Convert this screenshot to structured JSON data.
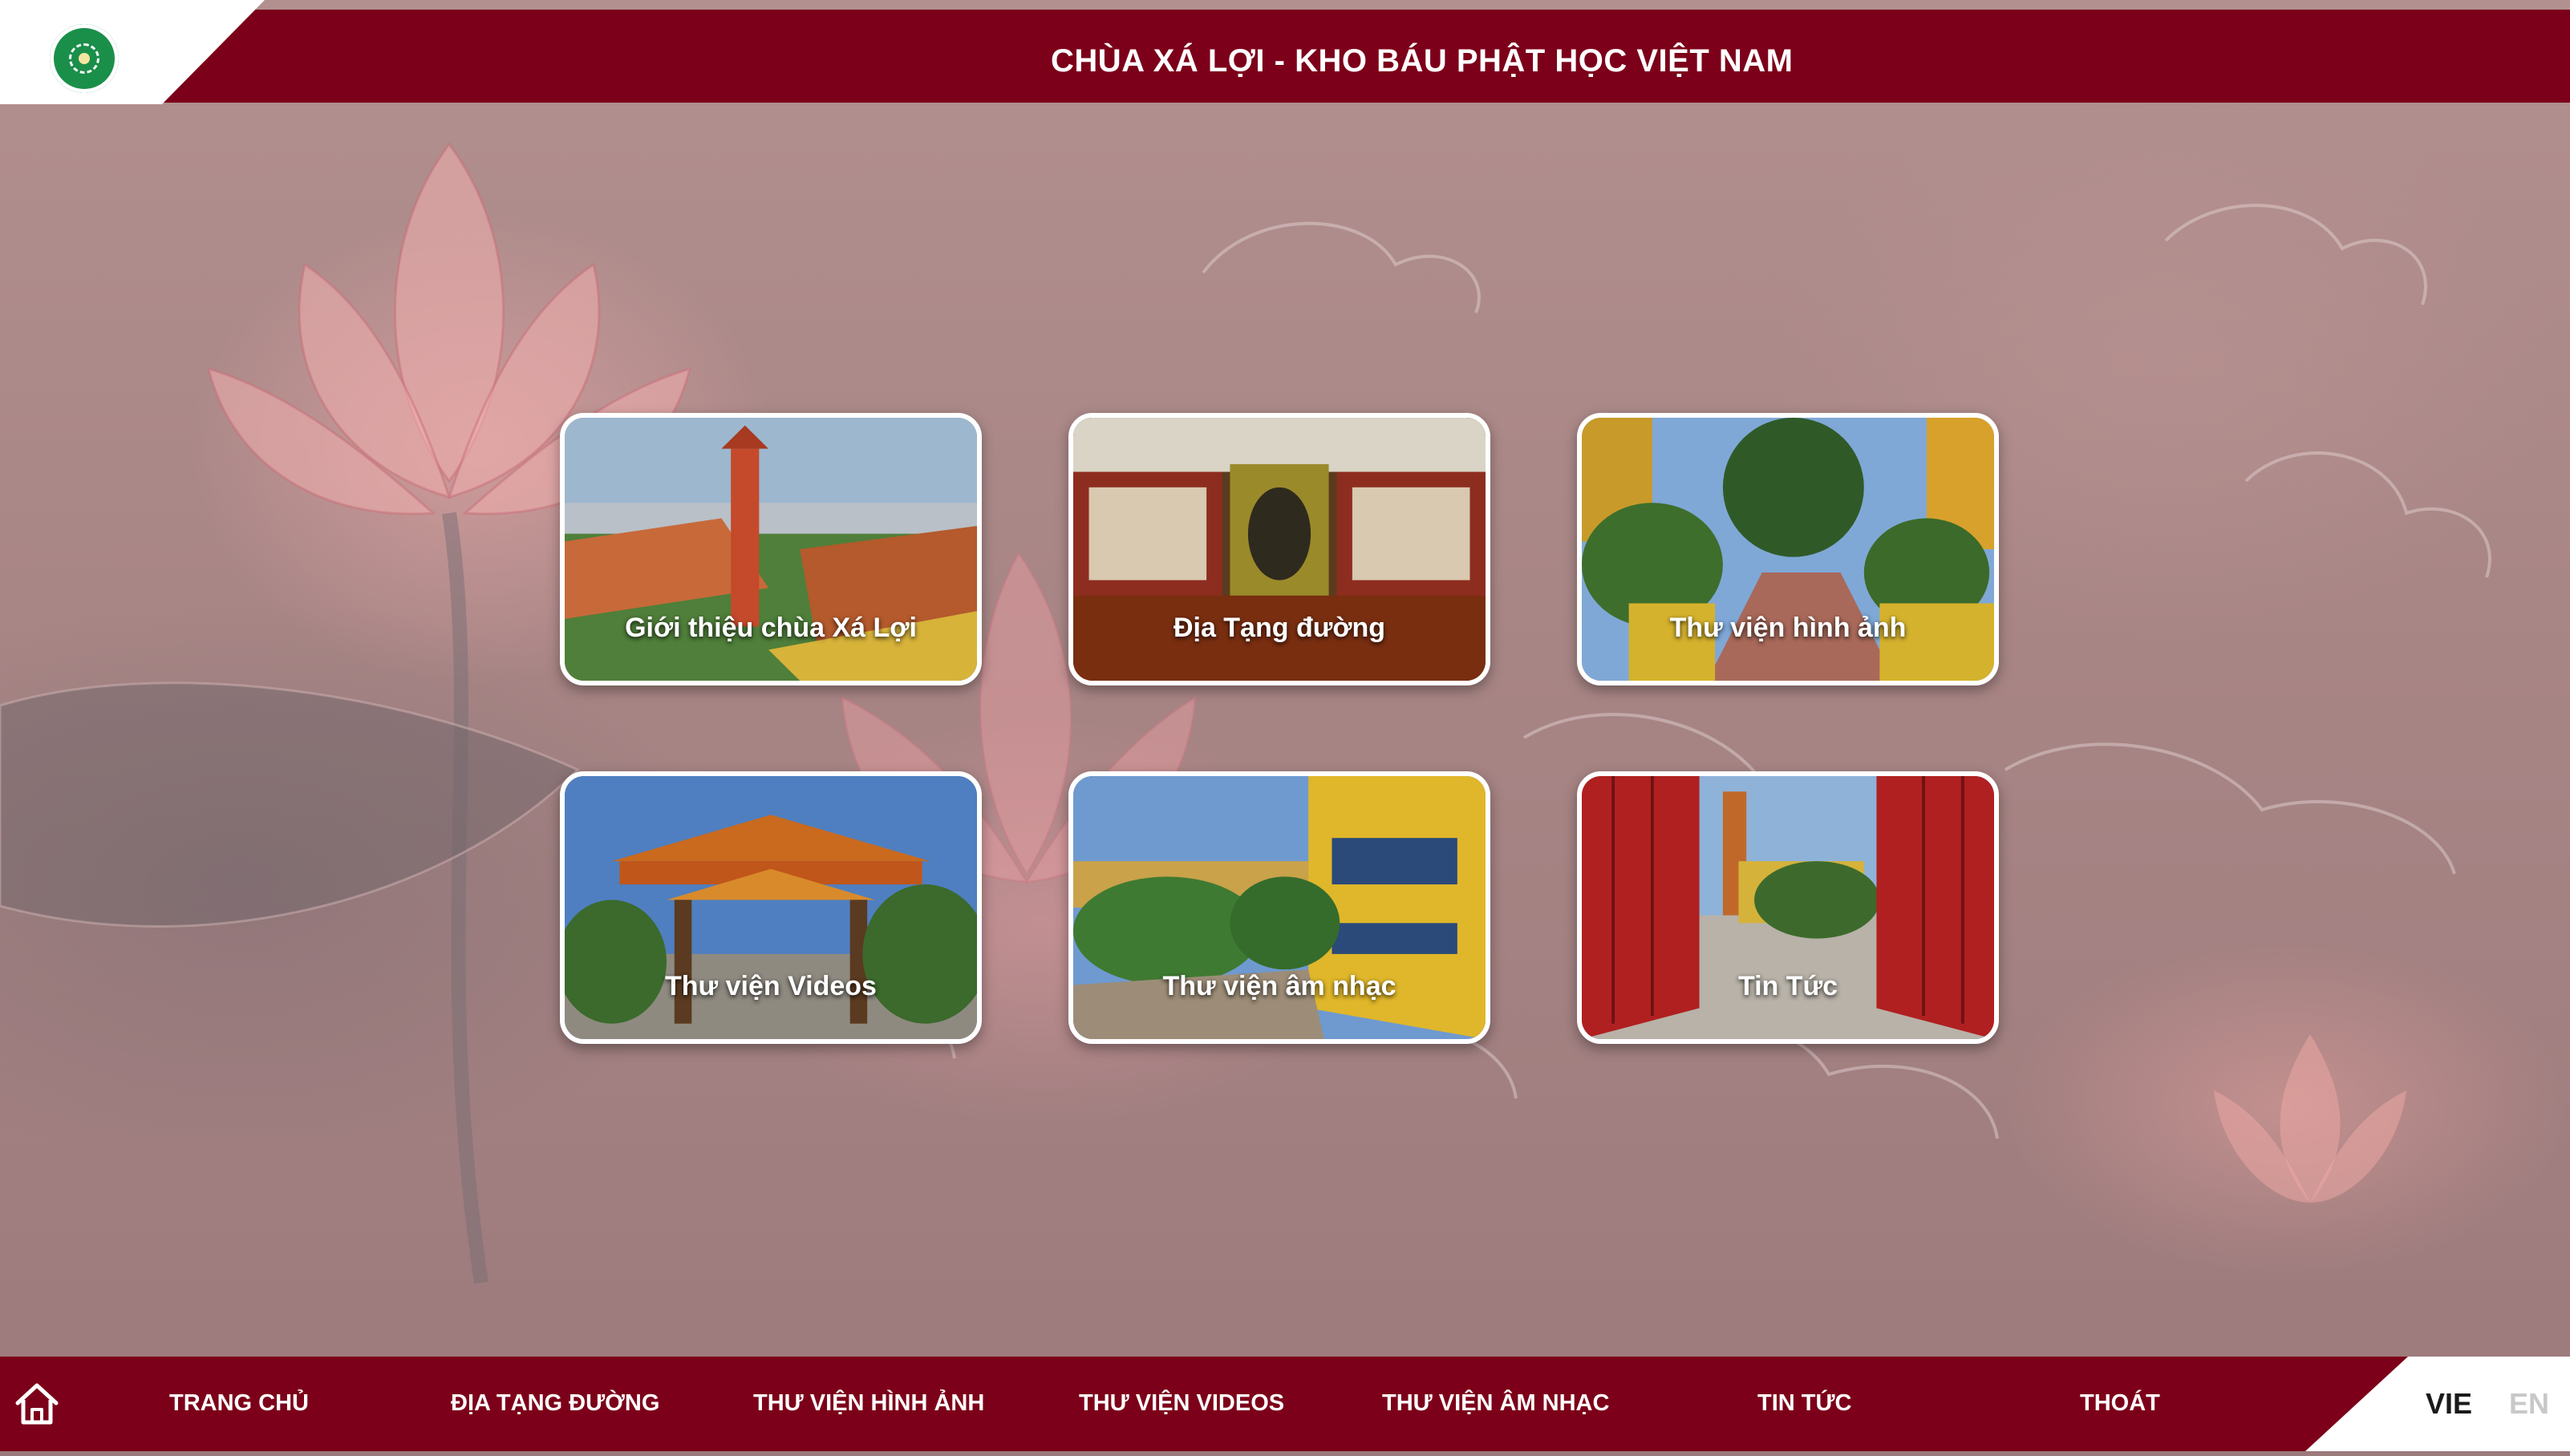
{
  "header": {
    "title": "CHÙA XÁ LỢI - KHO BÁU PHẬT HỌC VIỆT NAM",
    "logo_icon": "temple-logo-icon"
  },
  "tiles": [
    {
      "label": "Giới thiệu chùa Xá Lợi"
    },
    {
      "label": "Địa Tạng đường"
    },
    {
      "label": "Thư viện hình ảnh"
    },
    {
      "label": "Thư viện Videos"
    },
    {
      "label": "Thư viện âm nhạc"
    },
    {
      "label": "Tin Tức"
    }
  ],
  "footer": {
    "home_icon": "home-icon",
    "nav": [
      "TRANG CHỦ",
      "ĐỊA TẠNG ĐƯỜNG",
      "THƯ VIỆN HÌNH ẢNH",
      "THƯ VIỆN VIDEOS",
      "THƯ VIỆN ÂM NHẠC",
      "TIN TỨC",
      "THOÁT"
    ],
    "languages": [
      {
        "label": "VIE",
        "active": true
      },
      {
        "label": "EN",
        "active": false
      }
    ]
  },
  "colors": {
    "brand_red": "#7c0019",
    "active_lang": "#1a1a1a",
    "inactive_lang": "#c8c8c8"
  }
}
